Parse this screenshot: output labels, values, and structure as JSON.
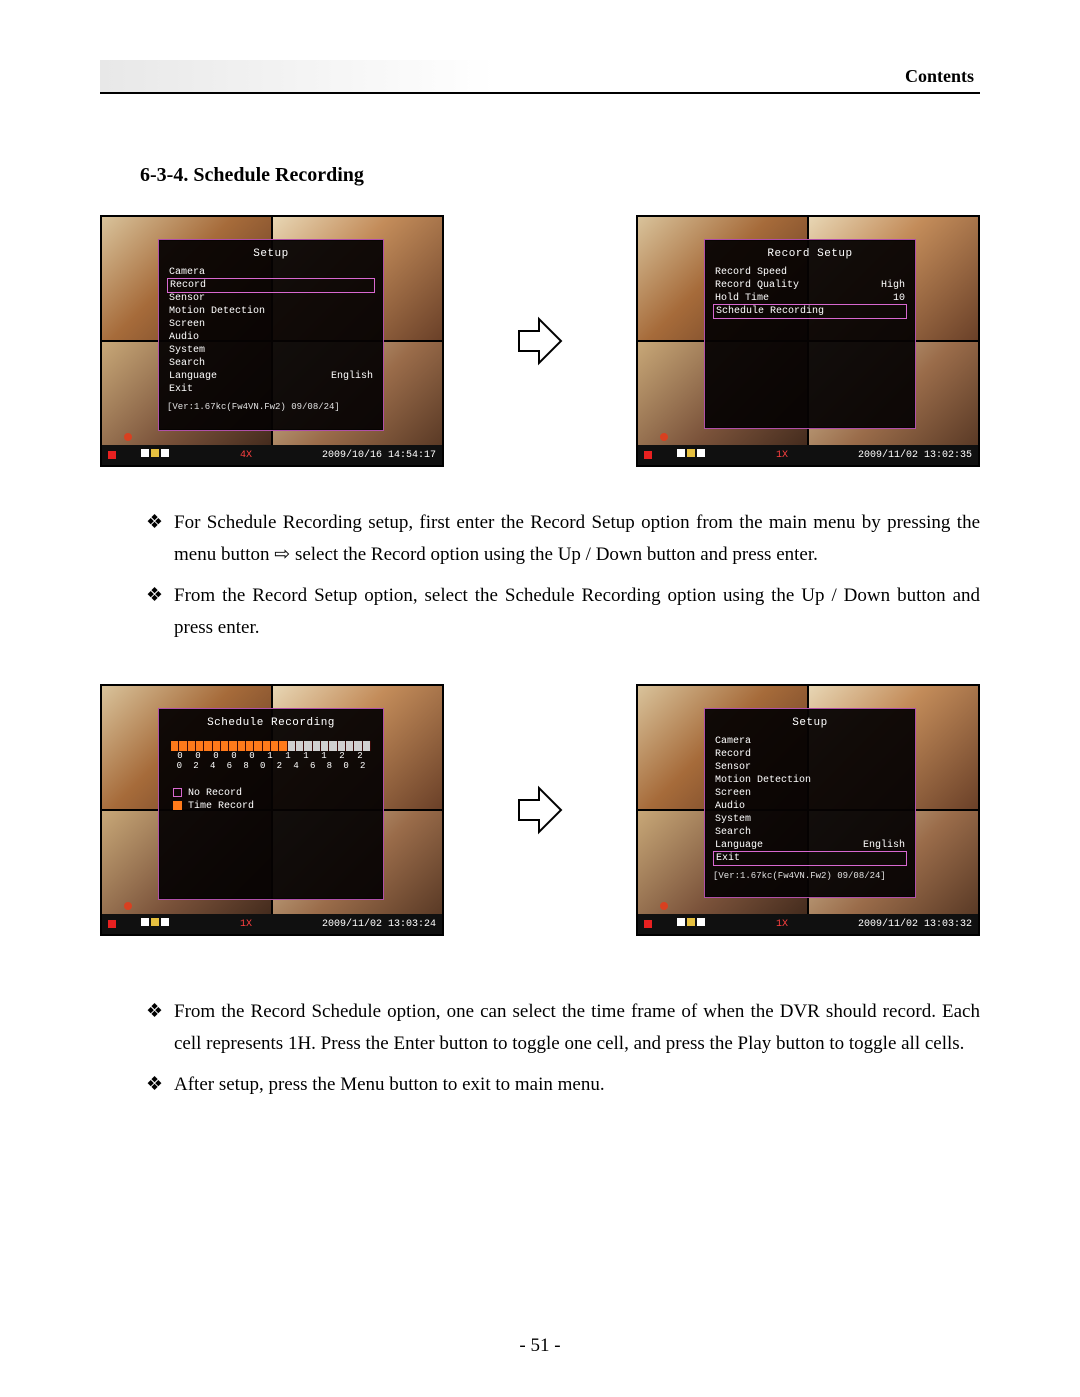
{
  "header": {
    "contents_label": "Contents"
  },
  "section": {
    "title": "6-3-4. Schedule Recording"
  },
  "bullets": {
    "top": [
      "For Schedule Recording setup, first enter the Record Setup option from the main menu by pressing the menu button ⇨ select the Record option using the Up / Down button and press enter.",
      "From the Record Setup option, select the Schedule Recording option using the Up / Down button and press enter."
    ],
    "bottom": [
      "From the Record Schedule option, one can select the time frame of when the DVR should record. Each cell represents 1H. Press the Enter button to toggle one cell, and press the Play button to toggle all cells.",
      "After setup, press the Menu button to exit to main menu."
    ]
  },
  "shots": {
    "setup_main": {
      "title": "Setup",
      "items": [
        {
          "label": "Camera",
          "value": ""
        },
        {
          "label": "Record",
          "value": "",
          "selected": true
        },
        {
          "label": "Sensor",
          "value": ""
        },
        {
          "label": "Motion Detection",
          "value": ""
        },
        {
          "label": "Screen",
          "value": ""
        },
        {
          "label": "Audio",
          "value": ""
        },
        {
          "label": "System",
          "value": ""
        },
        {
          "label": "Search",
          "value": ""
        },
        {
          "label": "Language",
          "value": "English"
        },
        {
          "label": "Exit",
          "value": ""
        }
      ],
      "version": "[Ver:1.67kc(Fw4VN.Fw2) 09/08/24]",
      "status": {
        "zoom": "4X",
        "time": "2009/10/16 14:54:17"
      }
    },
    "record_setup": {
      "title": "Record Setup",
      "items": [
        {
          "label": "Record Speed",
          "value": ""
        },
        {
          "label": "Record Quality",
          "value": "High"
        },
        {
          "label": "Hold Time",
          "value": "10"
        },
        {
          "label": "Schedule Recording",
          "value": "",
          "selected": true
        }
      ],
      "status": {
        "zoom": "1X",
        "time": "2009/11/02 13:02:35"
      }
    },
    "schedule": {
      "title": "Schedule Recording",
      "num_row1": [
        "0",
        "0",
        "0",
        "0",
        "0",
        "1",
        "1",
        "1",
        "1",
        "2",
        "2"
      ],
      "num_row2": [
        "0",
        "2",
        "4",
        "6",
        "8",
        "0",
        "2",
        "4",
        "6",
        "8",
        "0",
        "2"
      ],
      "legend": {
        "no": "No Record",
        "time": "Time Record"
      },
      "status": {
        "zoom": "1X",
        "time": "2009/11/02 13:03:24"
      }
    },
    "setup_exit": {
      "title": "Setup",
      "items": [
        {
          "label": "Camera",
          "value": ""
        },
        {
          "label": "Record",
          "value": ""
        },
        {
          "label": "Sensor",
          "value": ""
        },
        {
          "label": "Motion Detection",
          "value": ""
        },
        {
          "label": "Screen",
          "value": ""
        },
        {
          "label": "Audio",
          "value": ""
        },
        {
          "label": "System",
          "value": ""
        },
        {
          "label": "Search",
          "value": ""
        },
        {
          "label": "Language",
          "value": "English"
        },
        {
          "label": "Exit",
          "value": "",
          "selected": true
        }
      ],
      "version": "[Ver:1.67kc(Fw4VN.Fw2) 09/08/24]",
      "status": {
        "zoom": "1X",
        "time": "2009/11/02 13:03:32"
      }
    }
  },
  "page_number": "- 51 -"
}
